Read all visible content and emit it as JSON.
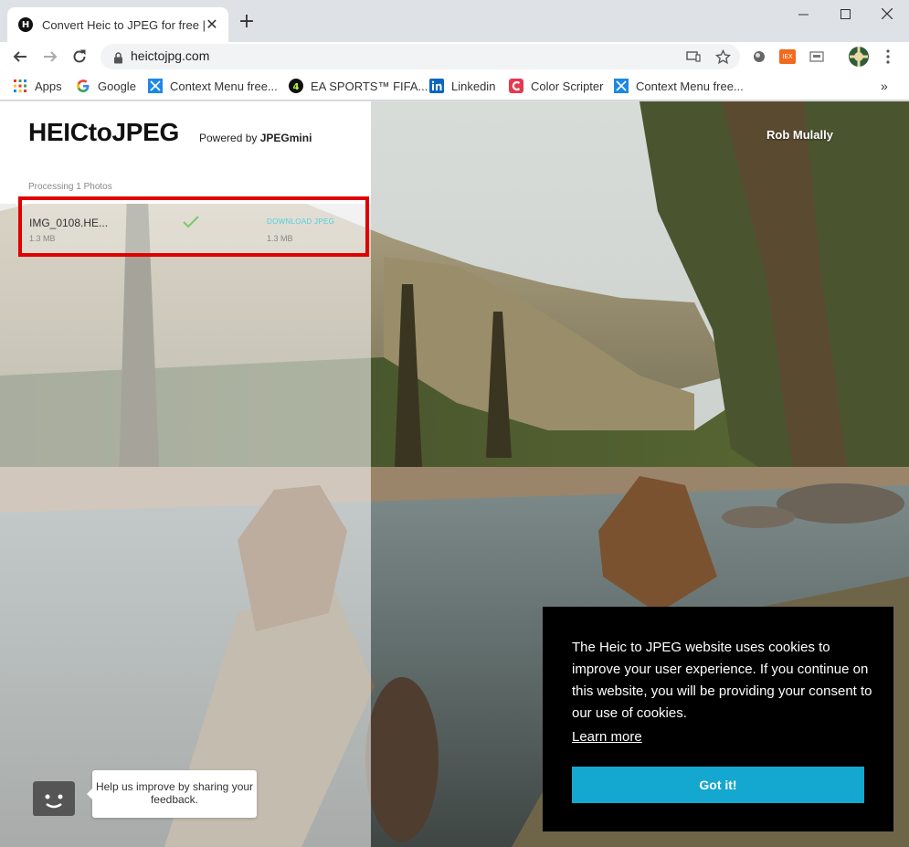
{
  "browser": {
    "tab_title": "Convert Heic to JPEG for free | I",
    "tab_favicon_letter": "H",
    "url": "heictojpg.com",
    "bookmarks": [
      {
        "label": "Apps",
        "icon": "apps-grid-icon"
      },
      {
        "label": "Google",
        "icon": "google-icon"
      },
      {
        "label": "Context Menu free...",
        "icon": "context-menu-icon"
      },
      {
        "label": "EA SPORTS™ FIFA...",
        "icon": "fifa-icon"
      },
      {
        "label": "Linkedin",
        "icon": "linkedin-icon"
      },
      {
        "label": "Color Scripter",
        "icon": "color-scripter-icon"
      },
      {
        "label": "Context Menu free...",
        "icon": "context-menu-icon"
      }
    ],
    "extension_badge": "IEX",
    "more_bookmarks": "»"
  },
  "app": {
    "logo": "HEICtoJPEG",
    "powered_prefix": "Powered by",
    "powered_brand": "JPEGmini",
    "processing_label": "Processing 1 Photos",
    "files": [
      {
        "name": "IMG_0108.HE...",
        "size": "1.3 MB",
        "action": "DOWNLOAD JPEG",
        "output_size": "1.3 MB"
      }
    ],
    "photo_credit": "Rob Mulally"
  },
  "feedback": {
    "text": "Help us improve by sharing your feedback."
  },
  "cookie": {
    "message": "The Heic to JPEG website uses cookies to improve your user experience. If you continue on this website, you will be providing your consent to our use of cookies.",
    "learn_more": "Learn more",
    "accept_label": "Got it!"
  },
  "colors": {
    "highlight": "#e00000",
    "cookie_button": "#14a7d0",
    "download_link": "#4dd0e1"
  }
}
